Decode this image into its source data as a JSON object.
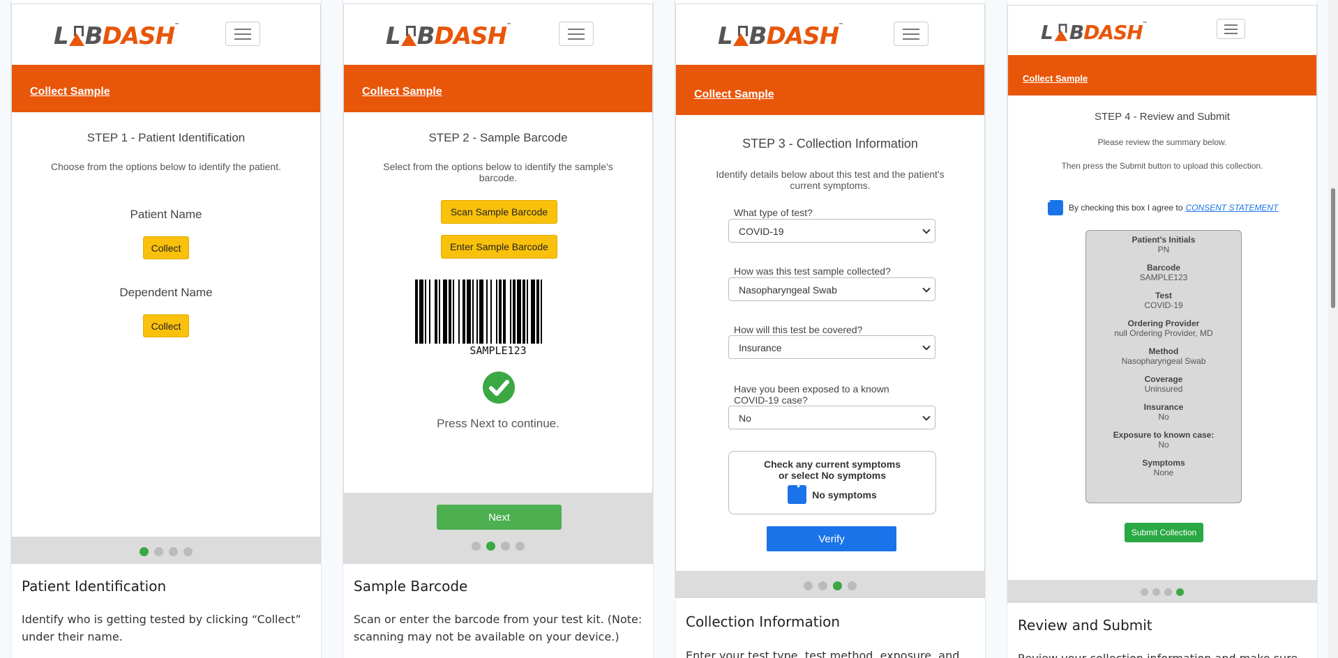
{
  "brand": {
    "logo_left": "L",
    "logo_mid": "B",
    "logo_right": "DASH",
    "trademark": "™"
  },
  "colors": {
    "brand_orange": "#e8560a",
    "button_yellow": "#f9c10b",
    "success_green": "#3ba843",
    "verify_blue": "#1a73e8"
  },
  "header": {
    "collect_link": "Collect Sample"
  },
  "cards": [
    {
      "step_title": "STEP 1 - Patient Identification",
      "instruction": "Choose from the options below to identify the patient.",
      "patient_label": "Patient Name",
      "patient_button": "Collect",
      "dependent_label": "Dependent Name",
      "dependent_button": "Collect",
      "active_step": 1,
      "caption_title": "Patient Identification",
      "caption_body": "Identify who is getting tested by clicking “Collect” under their name."
    },
    {
      "step_title": "STEP 2 - Sample Barcode",
      "instruction": "Select from the options below to identify the sample's barcode.",
      "scan_button": "Scan Sample Barcode",
      "enter_button": "Enter Sample Barcode",
      "barcode_text": "SAMPLE123",
      "press_next": "Press Next to continue.",
      "next_button": "Next",
      "active_step": 2,
      "caption_title": "Sample Barcode",
      "caption_body": "Scan or enter the barcode from your test kit. (Note: scanning may not be available on your device.)"
    },
    {
      "step_title": "STEP 3 - Collection Information",
      "instruction": "Identify details below about this test and the patient's current symptoms.",
      "q1": "What type of test?",
      "a1": "COVID-19",
      "q2": "How was this test sample collected?",
      "a2": "Nasopharyngeal Swab",
      "q3": "How will this test be covered?",
      "a3": "Insurance",
      "q4": "Have you been exposed to a known COVID-19 case?",
      "a4": "No",
      "symptoms_title_1": "Check any current symptoms",
      "symptoms_title_2": "or select No symptoms",
      "no_symptoms": "No symptoms",
      "verify_button": "Verify",
      "active_step": 3,
      "caption_title": "Collection Information",
      "caption_body": "Enter your test type, test method, exposure, and"
    },
    {
      "step_title": "STEP 4 - Review and Submit",
      "review_line": "Please review the summary below.",
      "submit_line": "Then press the Submit button to upload this collection.",
      "consent_prefix": "By checking this box I agree to",
      "consent_link": "CONSENT STATEMENT",
      "summary": [
        {
          "k": "Patient's Initials",
          "v": "PN"
        },
        {
          "k": "Barcode",
          "v": "SAMPLE123"
        },
        {
          "k": "Test",
          "v": "COVID-19"
        },
        {
          "k": "Ordering Provider",
          "v": "null Ordering Provider, MD"
        },
        {
          "k": "Method",
          "v": "Nasopharyngeal Swab"
        },
        {
          "k": "Coverage",
          "v": "Uninsured"
        },
        {
          "k": "Insurance",
          "v": "No"
        },
        {
          "k": "Exposure to known case:",
          "v": "No"
        },
        {
          "k": "Symptoms",
          "v": "None"
        }
      ],
      "submit_button": "Submit Collection",
      "active_step": 4,
      "caption_title": "Review and Submit",
      "caption_body": "Review your collection information and make sure it is"
    }
  ]
}
